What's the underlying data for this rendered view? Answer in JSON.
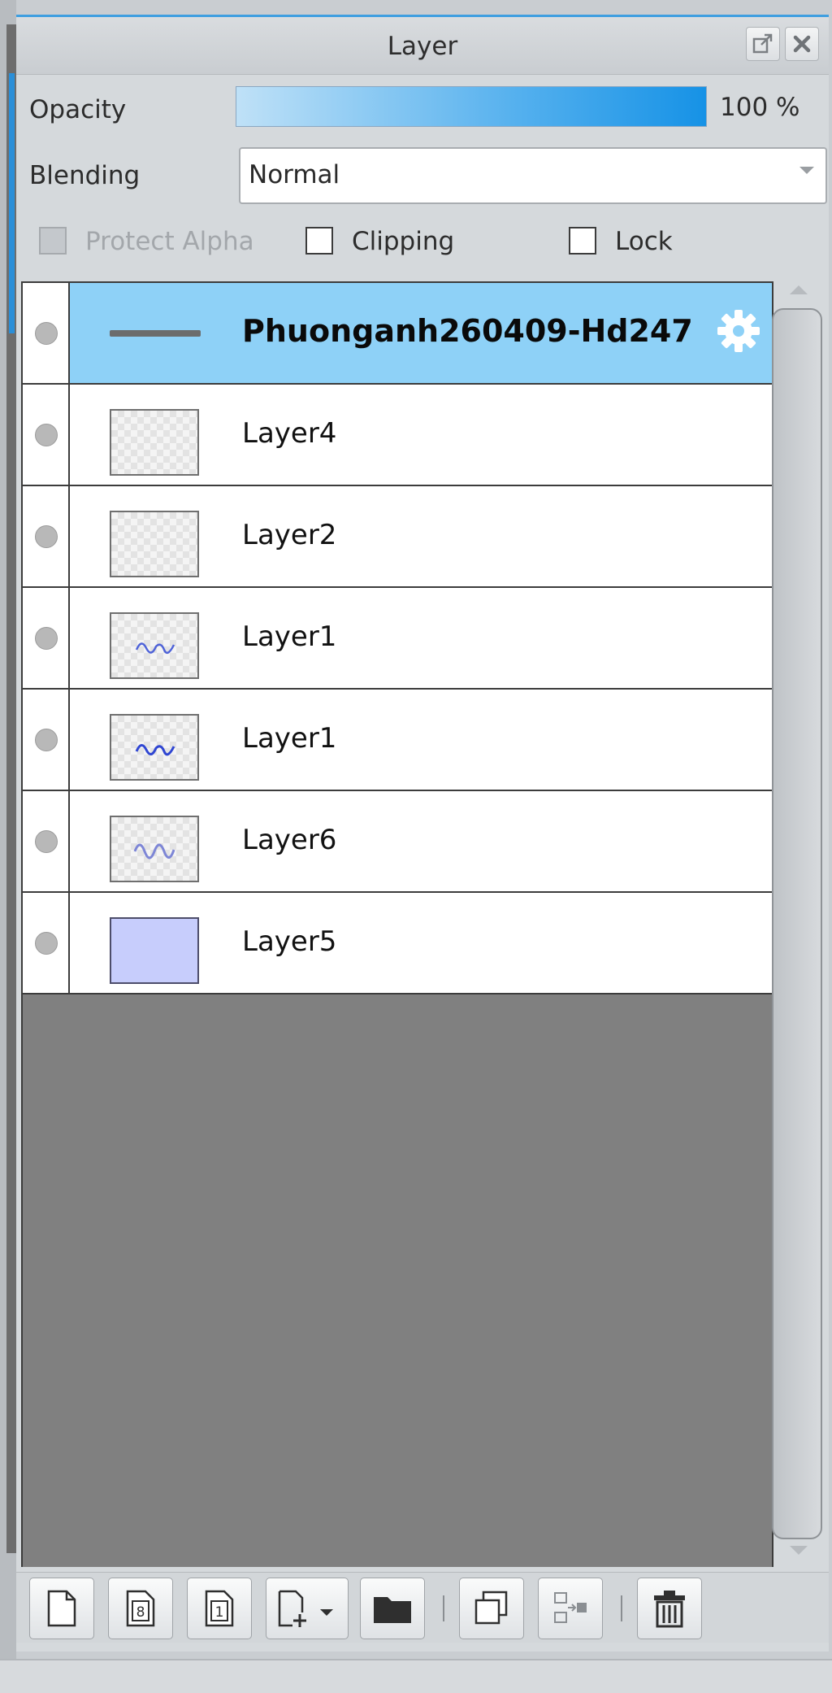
{
  "panel": {
    "title": "Layer",
    "opacity": {
      "label": "Opacity",
      "value": "100 %",
      "fraction": 1.0
    },
    "blending": {
      "label": "Blending",
      "value": "Normal"
    },
    "checkboxes": {
      "protect_alpha": {
        "label": "Protect Alpha",
        "checked": false,
        "disabled": true
      },
      "clipping": {
        "label": "Clipping",
        "checked": false
      },
      "lock": {
        "label": "Lock",
        "checked": false
      }
    }
  },
  "layers": [
    {
      "name": "Phuonganh260409-Hd247",
      "selected": true,
      "type": "folder"
    },
    {
      "name": "Layer4",
      "selected": false
    },
    {
      "name": "Layer2",
      "selected": false
    },
    {
      "name": "Layer1",
      "selected": false
    },
    {
      "name": "Layer1",
      "selected": false
    },
    {
      "name": "Layer6",
      "selected": false
    },
    {
      "name": "Layer5",
      "selected": false
    }
  ],
  "toolbar": {
    "icons": [
      "new-layer-icon",
      "new-8bit-layer-icon",
      "new-1bit-layer-icon",
      "add-layer-dropdown-icon",
      "folder-icon",
      "duplicate-layer-icon",
      "merge-down-icon",
      "trash-icon"
    ]
  }
}
